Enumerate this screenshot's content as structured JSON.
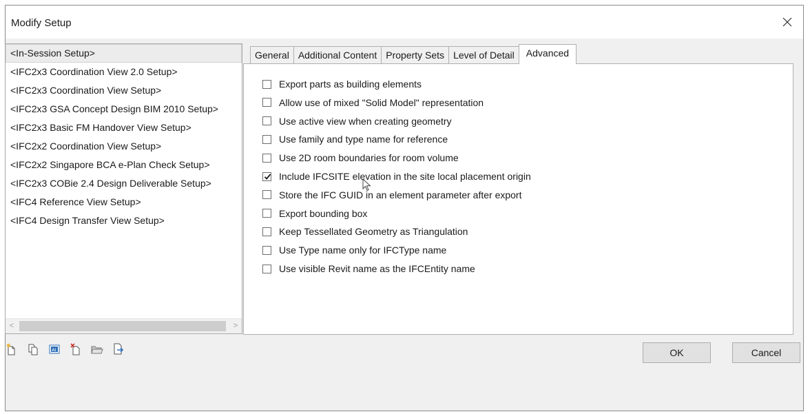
{
  "window": {
    "title": "Modify Setup",
    "close_icon": "close-icon"
  },
  "setup_list": {
    "items": [
      "<In-Session Setup>",
      "<IFC2x3 Coordination View 2.0 Setup>",
      "<IFC2x3 Coordination View Setup>",
      "<IFC2x3 GSA Concept Design BIM 2010 Setup>",
      "<IFC2x3 Basic FM Handover View Setup>",
      "<IFC2x2 Coordination View Setup>",
      "<IFC2x2 Singapore BCA e-Plan Check Setup>",
      "<IFC2x3 COBie 2.4 Design Deliverable Setup>",
      "<IFC4 Reference View Setup>",
      "<IFC4 Design Transfer View Setup>"
    ],
    "selected_index": 0
  },
  "tabs": [
    "General",
    "Additional Content",
    "Property Sets",
    "Level of Detail",
    "Advanced"
  ],
  "active_tab": "Advanced",
  "options": [
    {
      "label": "Export parts as building elements",
      "checked": false
    },
    {
      "label": "Allow use of mixed \"Solid Model\" representation",
      "checked": false
    },
    {
      "label": "Use active view when creating geometry",
      "checked": false
    },
    {
      "label": "Use family and type name for reference",
      "checked": false
    },
    {
      "label": "Use 2D room boundaries for room volume",
      "checked": false
    },
    {
      "label": "Include IFCSITE elevation in the site local placement origin",
      "checked": true
    },
    {
      "label": "Store the IFC GUID in an element parameter after export",
      "checked": false
    },
    {
      "label": "Export bounding box",
      "checked": false
    },
    {
      "label": "Keep Tessellated Geometry as Triangulation",
      "checked": false
    },
    {
      "label": "Use Type name only for IFCType name",
      "checked": false
    },
    {
      "label": "Use visible Revit name as the IFCEntity name",
      "checked": false
    }
  ],
  "toolbar": {
    "icons": [
      "new-setup-icon",
      "duplicate-setup-icon",
      "rename-setup-icon",
      "delete-setup-icon",
      "import-setup-icon",
      "export-setup-icon"
    ]
  },
  "buttons": {
    "ok": "OK",
    "cancel": "Cancel"
  },
  "colors": {
    "window_bg": "#f0f0f0",
    "panel_bg": "#ffffff",
    "check_accent": "#1a1a1a",
    "folder_yellow": "#e8b84a",
    "icon_blue": "#2f6fb7",
    "icon_red": "#c8352b"
  }
}
